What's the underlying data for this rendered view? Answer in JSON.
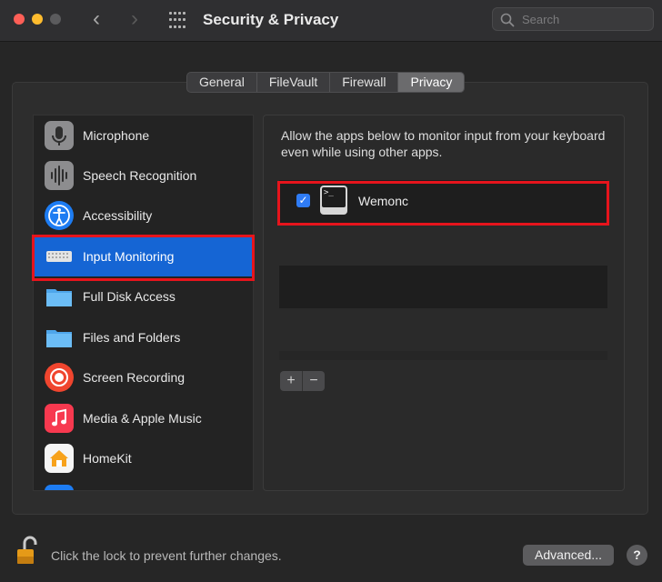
{
  "window": {
    "title": "Security & Privacy",
    "back_arrow": "‹",
    "forward_arrow": "›"
  },
  "search": {
    "placeholder": "Search",
    "value": ""
  },
  "tabs": [
    {
      "label": "General",
      "active": false
    },
    {
      "label": "FileVault",
      "active": false
    },
    {
      "label": "Firewall",
      "active": false
    },
    {
      "label": "Privacy",
      "active": true
    }
  ],
  "categories": [
    {
      "label": "Microphone",
      "icon": "microphone-icon",
      "color": "#8d8d8f",
      "selected": false
    },
    {
      "label": "Speech Recognition",
      "icon": "waveform-icon",
      "color": "#8d8d8f",
      "selected": false
    },
    {
      "label": "Accessibility",
      "icon": "accessibility-icon",
      "color": "#1d7cf2",
      "selected": false
    },
    {
      "label": "Input Monitoring",
      "icon": "keyboard-icon",
      "color": "#dcdcdc",
      "selected": true
    },
    {
      "label": "Full Disk Access",
      "icon": "folder-icon",
      "color": "#5eb3f4",
      "selected": false
    },
    {
      "label": "Files and Folders",
      "icon": "folder-icon",
      "color": "#5eb3f4",
      "selected": false
    },
    {
      "label": "Screen Recording",
      "icon": "record-icon",
      "color": "#f0452e",
      "selected": false
    },
    {
      "label": "Media & Apple Music",
      "icon": "music-note-icon",
      "color": "#f7394f",
      "selected": false
    },
    {
      "label": "HomeKit",
      "icon": "home-icon",
      "color": "#f5f5f5",
      "selected": false
    }
  ],
  "detail": {
    "description": "Allow the apps below to monitor input from your keyboard even while using other apps.",
    "apps": [
      {
        "name": "Wemonc",
        "checked": true,
        "check_glyph": "✓",
        "icon": "terminal-icon",
        "icon_text": ">_"
      }
    ],
    "add_label": "+",
    "remove_label": "−"
  },
  "footer": {
    "lock_text": "Click the lock to prevent further changes.",
    "advanced_label": "Advanced...",
    "help_label": "?"
  },
  "colors": {
    "selection": "#1565d4",
    "highlight": "#e6141c",
    "checkbox": "#2f7cf6"
  }
}
